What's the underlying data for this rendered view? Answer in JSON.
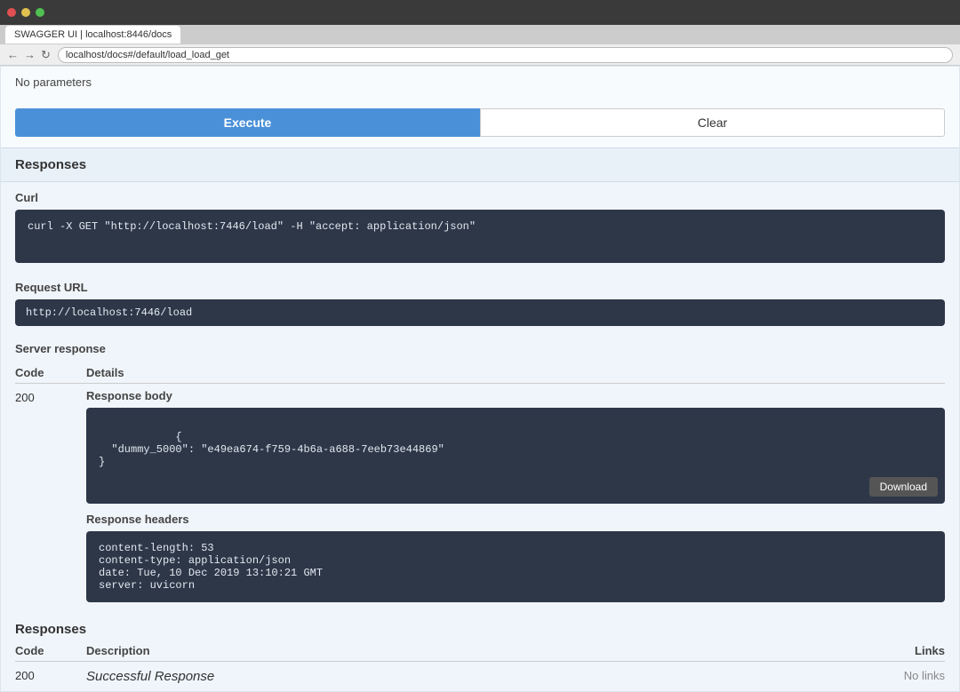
{
  "browser": {
    "tab_label": "SWAGGER UI | localhost:8446/docs",
    "url": "localhost/docs#/default/load_load_get"
  },
  "page": {
    "no_params": "No parameters",
    "execute_button": "Execute",
    "clear_button": "Clear",
    "responses_header": "Responses",
    "curl_label": "Curl",
    "curl_command": "curl -X GET \"http://localhost:7446/load\" -H \"accept: application/json\"",
    "request_url_label": "Request URL",
    "request_url": "http://localhost:7446/load",
    "server_response_label": "Server response",
    "code_col": "Code",
    "details_col": "Details",
    "response_code": "200",
    "response_body_label": "Response body",
    "response_body": "{\n  \"dummy_5000\": \"e49ea674-f759-4b6a-a688-7eeb73e44869\"\n}",
    "download_button": "Download",
    "response_headers_label": "Response headers",
    "response_headers": "content-length: 53\ncontent-type: application/json\ndate: Tue, 10 Dec 2019 13:10:21 GMT\nserver: uvicorn",
    "responses_section_header": "Responses",
    "responses_code_col": "Code",
    "responses_desc_col": "Description",
    "responses_links_col": "Links",
    "responses_200_code": "200",
    "responses_200_desc": "Successful Response",
    "responses_200_links": "No links"
  }
}
